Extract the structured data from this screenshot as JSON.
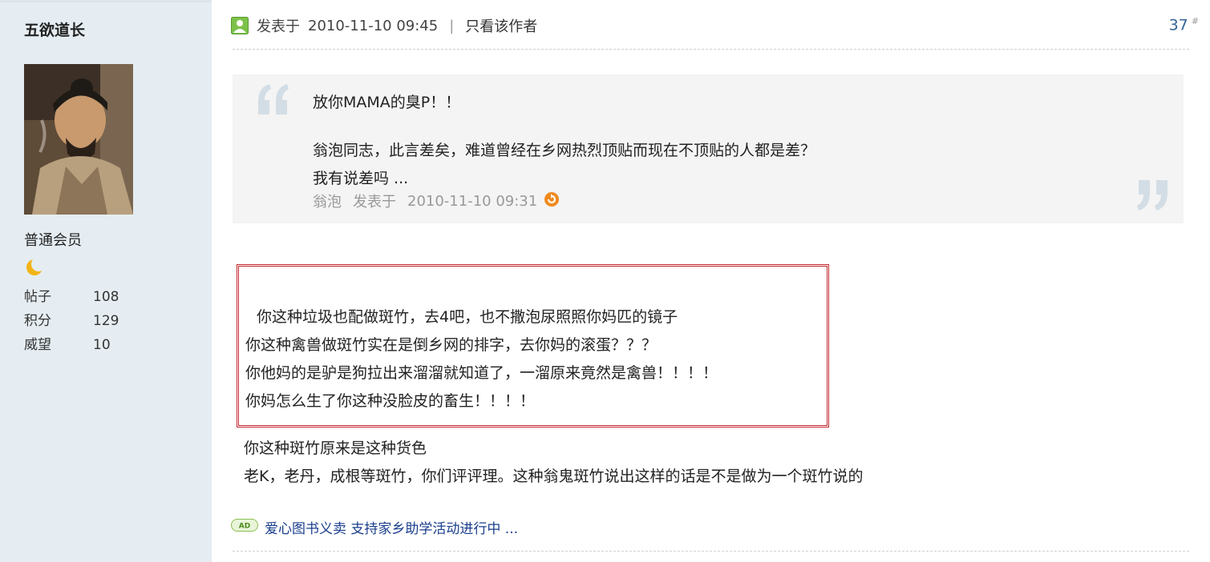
{
  "author": {
    "name": "五欲道长",
    "rank": "普通会员",
    "stats": [
      {
        "label": "帖子",
        "value": "108"
      },
      {
        "label": "积分",
        "value": "129"
      },
      {
        "label": "威望",
        "value": "10"
      }
    ],
    "rank_icon": "moon-icon"
  },
  "post": {
    "header": {
      "posted_prefix": "发表于",
      "datetime": "2010-11-10 09:45",
      "separator": "|",
      "only_author": "只看该作者",
      "floor": "37",
      "floor_mark": "#"
    },
    "quote": {
      "lines": [
        "放你MAMA的臭P！！",
        "翁泡同志，此言差矣，难道曾经在乡网热烈顶贴而现在不顶贴的人都是差？",
        "我有说差吗 ..."
      ],
      "author": "翁泡",
      "posted_prefix": "发表于",
      "datetime": "2010-11-10 09:31"
    },
    "boxed_lines": [
      "你这种垃圾也配做斑竹，去4吧，也不撒泡尿照照你妈匹的镜子",
      "你这种禽兽做斑竹实在是倒乡网的排字，去你妈的滚蛋？？？",
      "你他妈的是驴是狗拉出来溜溜就知道了，一溜原来竟然是禽兽！！！！",
      "你妈怎么生了你这种没脸皮的畜生！！！！"
    ],
    "body_lines": [
      "你这种斑竹原来是这种货色",
      "老K，老丹，成根等斑竹，你们评评理。这种翁鬼斑竹说出这样的话是不是做为一个斑竹说的"
    ],
    "ad": {
      "badge": "AD",
      "text": "爱心图书义卖 支持家乡助学活动进行中 ..."
    }
  },
  "colors": {
    "sidebar_bg": "#e5edf2",
    "quote_bg": "#f4f4f4",
    "redbox_border": "#c1272d",
    "link_blue": "#1a3e8c",
    "floor_blue": "#336699"
  }
}
